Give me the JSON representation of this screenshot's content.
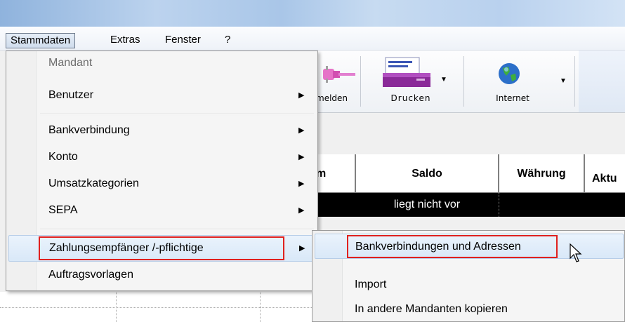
{
  "menubar": {
    "items": [
      {
        "label": "Stammdaten"
      },
      {
        "label": "Extras"
      },
      {
        "label": "Fenster"
      },
      {
        "label": "?"
      }
    ]
  },
  "toolbar": {
    "buttons": [
      {
        "label": "melden",
        "icon": "plug-icon"
      },
      {
        "label": "Drucken",
        "icon": "printer-icon"
      },
      {
        "label": "Internet",
        "icon": "globe-icon"
      }
    ]
  },
  "grid": {
    "headers": [
      "m",
      "Saldo",
      "Währung",
      "Aktu"
    ],
    "row_text": "liegt nicht vor"
  },
  "dropdown": {
    "items": [
      {
        "label": "Mandant",
        "disabled": true
      },
      {
        "label": "Benutzer",
        "submenu": true
      },
      {
        "label": "Bankverbindung",
        "submenu": true
      },
      {
        "label": "Konto",
        "submenu": true
      },
      {
        "label": "Umsatzkategorien",
        "submenu": true
      },
      {
        "label": "SEPA",
        "submenu": true
      },
      {
        "label": "Zahlungsempfänger /-pflichtige",
        "submenu": true,
        "highlighted": true
      },
      {
        "label": "Auftragsvorlagen"
      }
    ]
  },
  "submenu": {
    "items": [
      {
        "label": "Bankverbindungen und Adressen",
        "highlighted": true
      },
      {
        "label": "Import"
      },
      {
        "label": "In andere Mandanten kopieren"
      }
    ]
  },
  "colors": {
    "highlight_box": "#e0211f",
    "menu_hover": "#d9e8f8"
  }
}
